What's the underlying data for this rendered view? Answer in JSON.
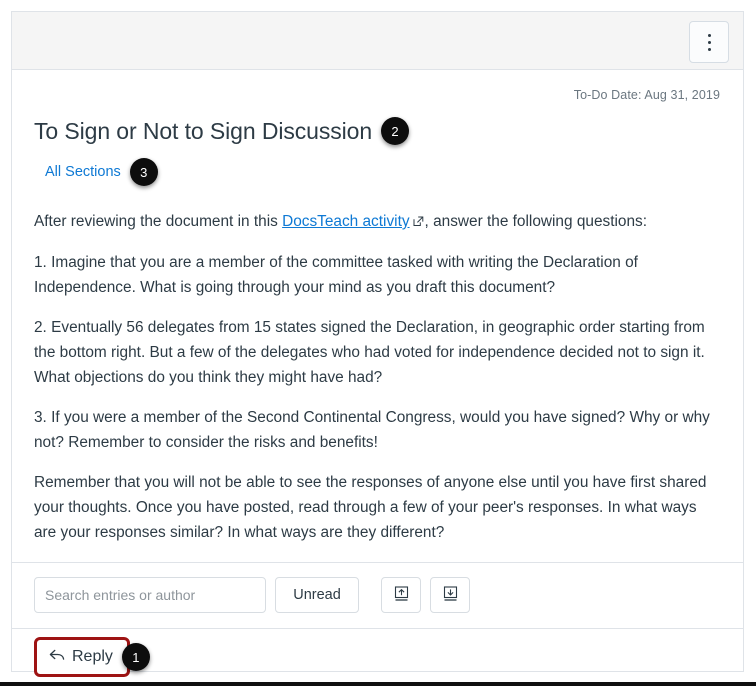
{
  "window": {
    "kebab_menu_label": "More options"
  },
  "header": {
    "todo_date": "To-Do Date: Aug 31, 2019"
  },
  "discussion": {
    "title": "To Sign or Not to Sign Discussion",
    "title_badge": "2",
    "sections_link": "All Sections",
    "sections_badge": "3"
  },
  "message": {
    "intro_before_link": "After reviewing the document in this ",
    "link_text": "DocsTeach activity",
    "intro_after_link": ", answer the following questions:",
    "paragraphs": [
      "1. Imagine that you are a member of the committee tasked with writing the Declaration of Independence. What is going through your mind as you draft this document?",
      "2. Eventually 56 delegates from 15 states signed the Declaration, in geographic order starting from the bottom right. But a few of the delegates who had voted for independence decided not to sign it. What objections do you think they might have had?",
      "3. If you were a member of the Second Continental Congress, would you have signed? Why or why not? Remember to consider the risks and benefits!",
      "Remember that you will not be able to see the responses of anyone else until you have first shared your thoughts. Once you have posted, read through a few of your peer's responses. In what ways are your responses similar? In what ways are they different?"
    ]
  },
  "toolbar": {
    "search_placeholder": "Search entries or author",
    "search_value": "",
    "unread_label": "Unread",
    "collapse_label": "Collapse threads",
    "expand_label": "Expand threads"
  },
  "reply": {
    "label": "Reply",
    "badge": "1"
  },
  "colors": {
    "link": "#0e79d4",
    "text": "#2d3b45",
    "muted": "#6b7780",
    "highlight_border": "#9e1313",
    "badge_bg": "#0d0d0d",
    "panel_border": "#dfe3e8",
    "topbar_bg": "#f5f5f5"
  }
}
